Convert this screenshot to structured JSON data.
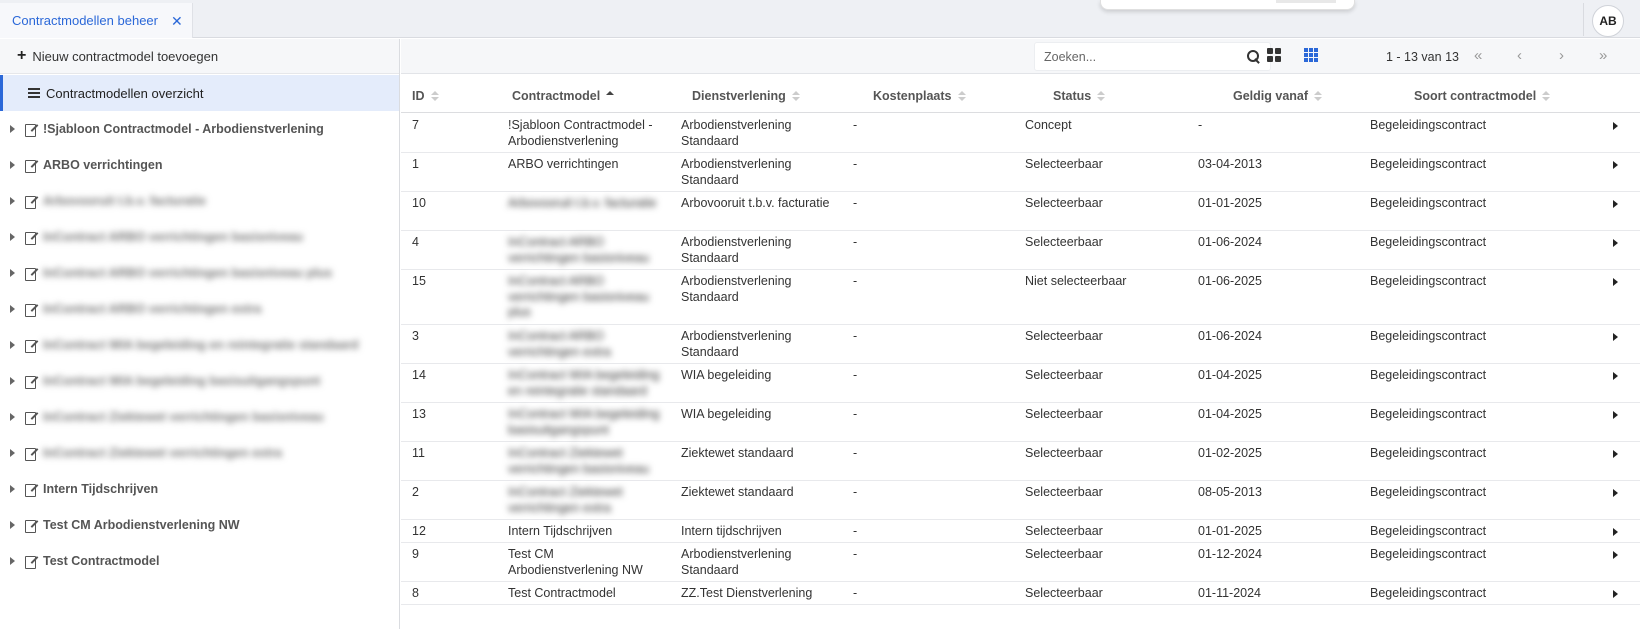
{
  "tab": {
    "label": "Contractmodellen beheer",
    "close": "✕"
  },
  "user": {
    "initials": "AB"
  },
  "sidebar": {
    "add_label": "Nieuw contractmodel toevoegen",
    "overview_label": "Contractmodellen overzicht",
    "items": [
      {
        "label": "!Sjabloon Contractmodel - Arbodienstverlening",
        "blurred": false
      },
      {
        "label": "ARBO verrichtingen",
        "blurred": false
      },
      {
        "label": "Arbovooruit t.b.v. facturatie",
        "blurred": true
      },
      {
        "label": "InContract ARBO verrichtingen basisniveau",
        "blurred": true
      },
      {
        "label": "InContract ARBO verrichtingen basisniveau plus",
        "blurred": true
      },
      {
        "label": "InContract ARBO verrichtingen extra",
        "blurred": true
      },
      {
        "label": "InContract WIA begeleiding en reintegratie standaard",
        "blurred": true
      },
      {
        "label": "InContract WIA begeleiding basisuitgangspunt",
        "blurred": true
      },
      {
        "label": "InContract Ziektewet verrichtingen basisniveau",
        "blurred": true
      },
      {
        "label": "InContract Ziektewet verrichtingen extra",
        "blurred": true
      },
      {
        "label": "Intern Tijdschrijven",
        "blurred": false
      },
      {
        "label": "Test CM Arbodienstverlening NW",
        "blurred": false
      },
      {
        "label": "Test Contractmodel",
        "blurred": false
      }
    ]
  },
  "toolbar": {
    "search_placeholder": "Zoeken...",
    "pager_text": "1 - 13 van 13",
    "first": "«",
    "prev": "‹",
    "next": "›",
    "last": "»"
  },
  "table": {
    "headers": {
      "id": "ID",
      "contractmodel": "Contractmodel",
      "dienstverlening": "Dienstverlening",
      "kostenplaats": "Kostenplaats",
      "status": "Status",
      "geldig": "Geldig vanaf",
      "soort": "Soort contractmodel"
    },
    "rows": [
      {
        "id": "7",
        "cm": "!Sjabloon Contractmodel - Arbodienstverlening",
        "cm_blur": false,
        "dv": "Arbodienstverlening Standaard",
        "kp": "-",
        "status": "Concept",
        "geldig": "-",
        "soort": "Begeleidingscontract",
        "h": 39
      },
      {
        "id": "1",
        "cm": "ARBO verrichtingen",
        "cm_blur": false,
        "dv": "Arbodienstverlening Standaard",
        "kp": "-",
        "status": "Selecteerbaar",
        "geldig": "03-04-2013",
        "soort": "Begeleidingscontract",
        "h": 39
      },
      {
        "id": "10",
        "cm": "Arbovooruit t.b.v. facturatie",
        "cm_blur": true,
        "dv": "Arbovooruit t.b.v. facturatie",
        "kp": "-",
        "status": "Selecteerbaar",
        "geldig": "01-01-2025",
        "soort": "Begeleidingscontract",
        "h": 39
      },
      {
        "id": "4",
        "cm": "InContract ARBO verrichtingen basisniveau",
        "cm_blur": true,
        "dv": "Arbodienstverlening Standaard",
        "kp": "-",
        "status": "Selecteerbaar",
        "geldig": "01-06-2024",
        "soort": "Begeleidingscontract",
        "h": 39
      },
      {
        "id": "15",
        "cm": "InContract ARBO verrichtingen basisniveau plus",
        "cm_blur": true,
        "dv": "Arbodienstverlening Standaard",
        "kp": "-",
        "status": "Niet selecteerbaar",
        "geldig": "01-06-2025",
        "soort": "Begeleidingscontract",
        "h": 55
      },
      {
        "id": "3",
        "cm": "InContract ARBO verrichtingen extra",
        "cm_blur": true,
        "dv": "Arbodienstverlening Standaard",
        "kp": "-",
        "status": "Selecteerbaar",
        "geldig": "01-06-2024",
        "soort": "Begeleidingscontract",
        "h": 39
      },
      {
        "id": "14",
        "cm": "InContract WIA begeleiding en reintegratie standaard",
        "cm_blur": true,
        "dv": "WIA begeleiding",
        "kp": "-",
        "status": "Selecteerbaar",
        "geldig": "01-04-2025",
        "soort": "Begeleidingscontract",
        "h": 39
      },
      {
        "id": "13",
        "cm": "InContract WIA begeleiding basisuitgangspunt",
        "cm_blur": true,
        "dv": "WIA begeleiding",
        "kp": "-",
        "status": "Selecteerbaar",
        "geldig": "01-04-2025",
        "soort": "Begeleidingscontract",
        "h": 39
      },
      {
        "id": "11",
        "cm": "InContract Ziektewet verrichtingen basisniveau",
        "cm_blur": true,
        "dv": "Ziektewet standaard",
        "kp": "-",
        "status": "Selecteerbaar",
        "geldig": "01-02-2025",
        "soort": "Begeleidingscontract",
        "h": 39
      },
      {
        "id": "2",
        "cm": "InContract Ziektewet verrichtingen extra",
        "cm_blur": true,
        "dv": "Ziektewet standaard",
        "kp": "-",
        "status": "Selecteerbaar",
        "geldig": "08-05-2013",
        "soort": "Begeleidingscontract",
        "h": 39
      },
      {
        "id": "12",
        "cm": "Intern Tijdschrijven",
        "cm_blur": false,
        "dv": "Intern tijdschrijven",
        "kp": "-",
        "status": "Selecteerbaar",
        "geldig": "01-01-2025",
        "soort": "Begeleidingscontract",
        "h": 23
      },
      {
        "id": "9",
        "cm": "Test CM Arbodienstverlening NW",
        "cm_blur": false,
        "dv": "Arbodienstverlening Standaard",
        "kp": "-",
        "status": "Selecteerbaar",
        "geldig": "01-12-2024",
        "soort": "Begeleidingscontract",
        "h": 39
      },
      {
        "id": "8",
        "cm": "Test Contractmodel",
        "cm_blur": false,
        "dv": "ZZ.Test Dienstverlening",
        "kp": "-",
        "status": "Selecteerbaar",
        "geldig": "01-11-2024",
        "soort": "Begeleidingscontract",
        "h": 23
      }
    ]
  }
}
